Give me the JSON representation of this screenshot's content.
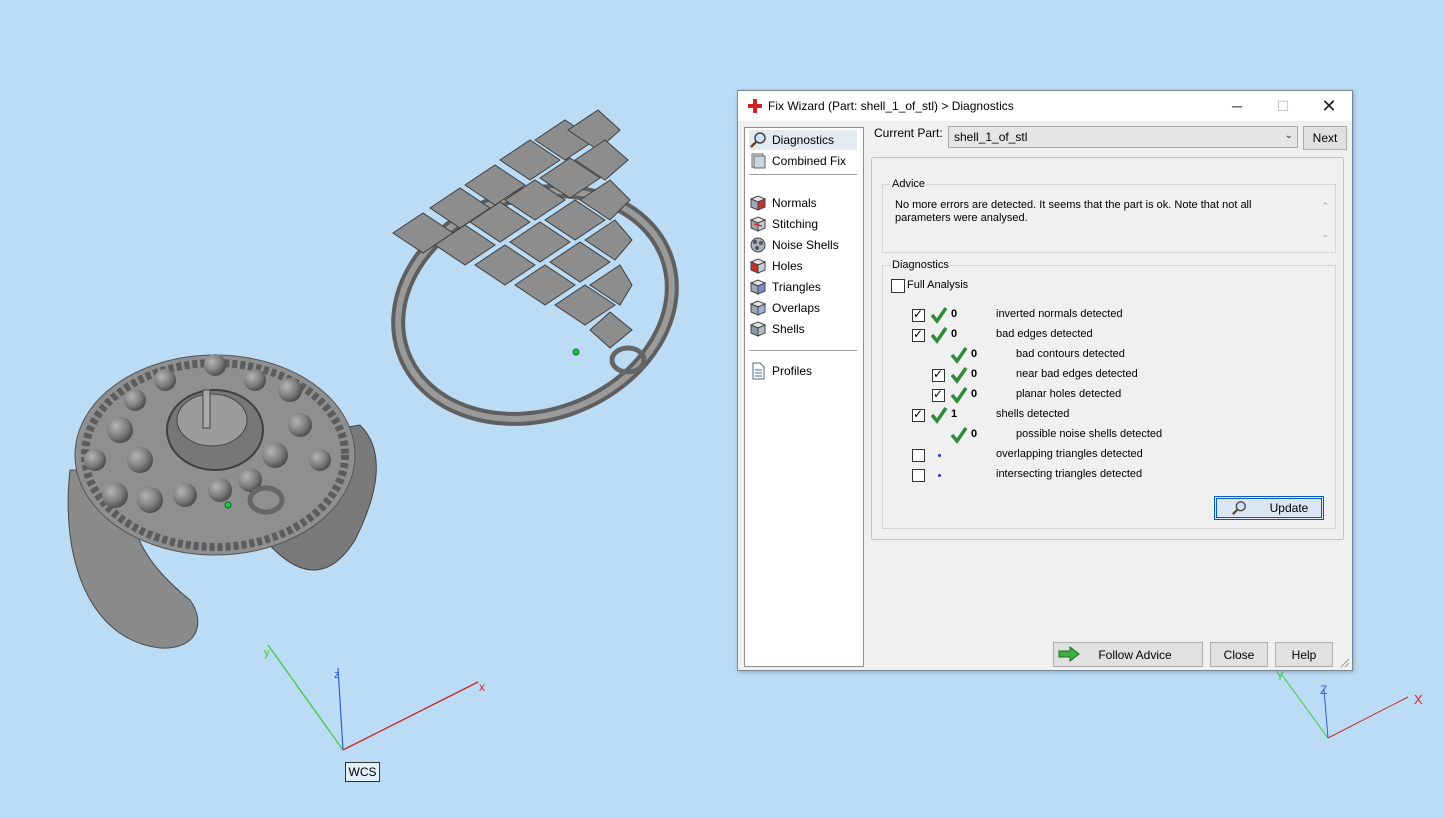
{
  "viewport": {
    "left_axes": {
      "x_label": "x",
      "y_label": "y",
      "z_label": "z"
    },
    "wcs_label": "WCS",
    "right_axes": {
      "x_label": "X",
      "y_label": "Y",
      "z_label": "Z"
    },
    "background_color": "#bcdcf6"
  },
  "dialog": {
    "title": "Fix Wizard (Part: shell_1_of_stl) > Diagnostics",
    "window_controls": {
      "minimize": "─",
      "maximize": "☐",
      "close": "✕"
    },
    "sidebar": {
      "items": [
        {
          "label": "Diagnostics",
          "icon": "magnifier-icon",
          "selected": true
        },
        {
          "label": "Combined Fix",
          "icon": "combined-fix-icon"
        },
        {
          "label": "Normals",
          "icon": "normals-cube-icon"
        },
        {
          "label": "Stitching",
          "icon": "stitching-cube-icon"
        },
        {
          "label": "Noise Shells",
          "icon": "noise-shells-icon"
        },
        {
          "label": "Holes",
          "icon": "holes-cube-icon"
        },
        {
          "label": "Triangles",
          "icon": "triangles-cube-icon"
        },
        {
          "label": "Overlaps",
          "icon": "overlaps-cube-icon"
        },
        {
          "label": "Shells",
          "icon": "shells-cube-icon"
        },
        {
          "label": "Profiles",
          "icon": "profiles-document-icon"
        }
      ]
    },
    "current_part": {
      "label": "Current Part:",
      "value": "shell_1_of_stl"
    },
    "next_button": "Next",
    "advice": {
      "title": "Advice",
      "text": "No more errors are detected. It seems that the part is ok. Note that not all parameters were analysed."
    },
    "diagnostics": {
      "title": "Diagnostics",
      "full_analysis": {
        "label": "Full Analysis",
        "checked": false
      },
      "rows": [
        {
          "checked": true,
          "status": "ok",
          "count": "0",
          "label": "inverted normals detected"
        },
        {
          "checked": true,
          "status": "ok",
          "count": "0",
          "label": "bad edges detected"
        },
        {
          "checked": null,
          "status": "ok",
          "count": "0",
          "label": "bad contours detected"
        },
        {
          "checked": true,
          "status": "ok",
          "count": "0",
          "label": "near bad edges detected"
        },
        {
          "checked": true,
          "status": "ok",
          "count": "0",
          "label": "planar holes detected"
        },
        {
          "checked": true,
          "status": "ok",
          "count": "1",
          "label": "shells detected"
        },
        {
          "checked": null,
          "status": "ok",
          "count": "0",
          "label": "possible noise shells detected"
        },
        {
          "checked": false,
          "status": "not-analysed",
          "count": "",
          "label": "overlapping triangles detected"
        },
        {
          "checked": false,
          "status": "not-analysed",
          "count": "",
          "label": "intersecting triangles detected"
        }
      ],
      "update_button": "Update"
    },
    "buttons": {
      "follow_advice": "Follow Advice",
      "close": "Close",
      "help": "Help"
    },
    "colors": {
      "check_green": "#2e8b3a",
      "focus_blue": "#0a59c4"
    }
  }
}
